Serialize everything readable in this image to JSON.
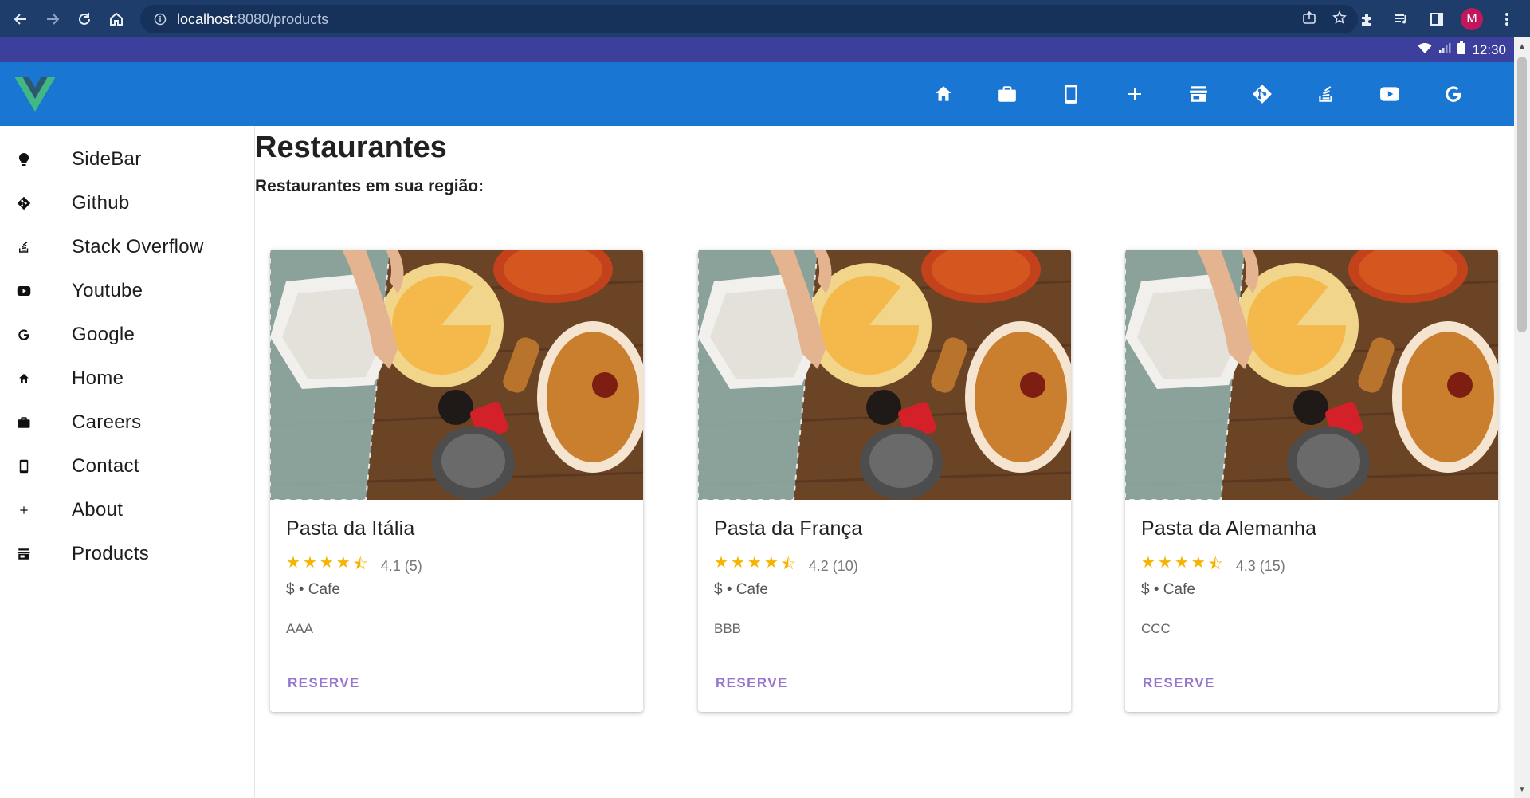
{
  "browser": {
    "url_host": "localhost",
    "url_rest": ":8080/products",
    "avatar_letter": "M"
  },
  "statusbar": {
    "time": "12:30"
  },
  "appbar": {
    "icons": [
      "home-icon",
      "briefcase-icon",
      "phone-icon",
      "plus-icon",
      "store-icon",
      "git-icon",
      "stack-overflow-icon",
      "youtube-icon",
      "google-icon"
    ]
  },
  "sidebar": {
    "items": [
      {
        "label": "SideBar",
        "icon": "lightbulb-icon"
      },
      {
        "label": "Github",
        "icon": "git-icon"
      },
      {
        "label": "Stack Overflow",
        "icon": "stack-overflow-icon"
      },
      {
        "label": "Youtube",
        "icon": "youtube-icon"
      },
      {
        "label": "Google",
        "icon": "google-icon"
      },
      {
        "label": "Home",
        "icon": "home-icon"
      },
      {
        "label": "Careers",
        "icon": "briefcase-icon"
      },
      {
        "label": "Contact",
        "icon": "phone-icon"
      },
      {
        "label": "About",
        "icon": "plus-icon"
      },
      {
        "label": "Products",
        "icon": "store-icon"
      }
    ]
  },
  "main": {
    "title": "Restaurantes",
    "subtitle": "Restaurantes em sua região:"
  },
  "cards": [
    {
      "title": "Pasta da Itália",
      "rating": 4.1,
      "rating_text": "4.1 (5)",
      "meta": "$ • Cafe",
      "description": "AAA",
      "button": "RESERVE"
    },
    {
      "title": "Pasta da França",
      "rating": 4.2,
      "rating_text": "4.2 (10)",
      "meta": "$ • Cafe",
      "description": "BBB",
      "button": "RESERVE"
    },
    {
      "title": "Pasta da Alemanha",
      "rating": 4.3,
      "rating_text": "4.3 (15)",
      "meta": "$ • Cafe",
      "description": "CCC",
      "button": "RESERVE"
    }
  ],
  "colors": {
    "appbar": "#1976d2",
    "statusbar": "#3c3f9c",
    "star": "#f5b400",
    "button_text": "#9575cd"
  }
}
